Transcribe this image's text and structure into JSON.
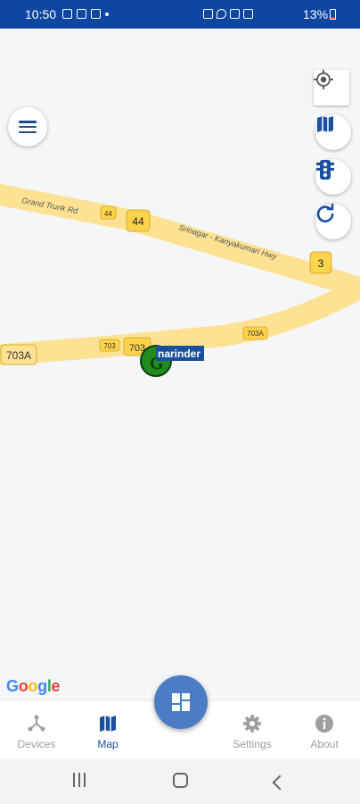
{
  "status_bar": {
    "time": "10:50",
    "battery_pct": "13%",
    "left_icons": [
      "image-icon",
      "media-icon",
      "lock-icon",
      "dot-icon"
    ],
    "right_icons": [
      "alarm-icon",
      "location-icon",
      "wifi-icon",
      "signal-icon"
    ]
  },
  "map": {
    "roads": {
      "grand_trunk_name": "Grand Trunk Rd",
      "grand_trunk_shield": "44",
      "nh44_shield": "44",
      "highway_name": "Srinagar - Kanyakumari Hwy",
      "nh3_shield": "3",
      "road_703a_left": "703A",
      "road_703_small": "703",
      "road_703_partial": "703",
      "road_703a_right": "703A"
    },
    "marker": {
      "letter": "G",
      "label": "narinder"
    },
    "attribution": "Google"
  },
  "controls": {
    "menu": "menu-icon",
    "locate": "crosshair-icon",
    "map_type": "map-icon",
    "traffic": "traffic-light-icon",
    "refresh": "refresh-icon"
  },
  "bottom_nav": {
    "items": [
      {
        "label": "Devices",
        "icon": "devices-icon",
        "active": false
      },
      {
        "label": "Map",
        "icon": "map-icon",
        "active": true
      },
      {
        "label": "Settings",
        "icon": "gear-icon",
        "active": false
      },
      {
        "label": "About",
        "icon": "info-icon",
        "active": false
      }
    ],
    "center_button_icon": "dashboard-icon"
  },
  "colors": {
    "accent": "#1a4fa0",
    "status_bar": "#0d47a1",
    "road": "#fde293",
    "shield": "#fcd34d",
    "marker_green": "#1e8c1e"
  }
}
